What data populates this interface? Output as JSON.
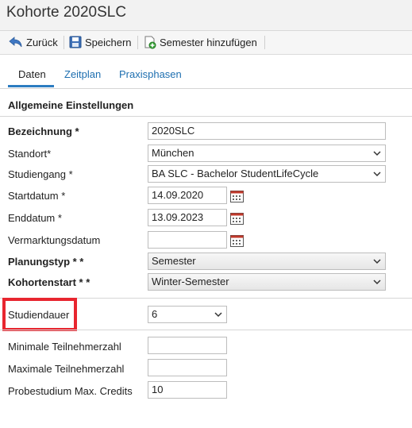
{
  "header": {
    "title": "Kohorte 2020SLC"
  },
  "toolbar": {
    "back_label": "Zurück",
    "save_label": "Speichern",
    "add_semester_label": "Semester hinzufügen"
  },
  "tabs": [
    {
      "label": "Daten",
      "active": true
    },
    {
      "label": "Zeitplan",
      "active": false
    },
    {
      "label": "Praxisphasen",
      "active": false
    }
  ],
  "section": {
    "title": "Allgemeine Einstellungen"
  },
  "fields": {
    "bezeichnung": {
      "label": "Bezeichnung *",
      "value": "2020SLC"
    },
    "standort": {
      "label": "Standort*",
      "value": "München"
    },
    "studiengang": {
      "label": "Studiengang *",
      "value": "BA SLC - Bachelor StudentLifeCycle"
    },
    "startdatum": {
      "label": "Startdatum *",
      "value": "14.09.2020"
    },
    "enddatum": {
      "label": "Enddatum *",
      "value": "13.09.2023"
    },
    "vermarktungsdatum": {
      "label": "Vermarktungsdatum",
      "value": ""
    },
    "planungstyp": {
      "label": "Planungstyp * *",
      "value": "Semester"
    },
    "kohortenstart": {
      "label": "Kohortenstart * *",
      "value": "Winter-Semester"
    },
    "studiendauer": {
      "label": "Studiendauer",
      "value": "6"
    },
    "min_teilnehmer": {
      "label": "Minimale Teilnehmerzahl",
      "value": ""
    },
    "max_teilnehmer": {
      "label": "Maximale Teilnehmerzahl",
      "value": ""
    },
    "probestudium": {
      "label": "Probestudium Max. Credits",
      "value": "10"
    }
  },
  "colors": {
    "accent": "#2c7cc1",
    "link": "#1e6fb0",
    "highlight": "#e8262f"
  }
}
